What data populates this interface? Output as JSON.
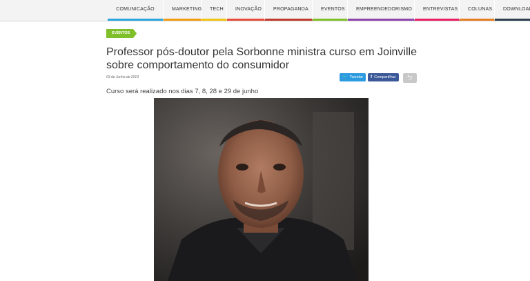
{
  "nav": [
    {
      "label": "COMUNICAÇÃO",
      "color": "#2aa6de"
    },
    {
      "label": "MARKETING",
      "color": "#f39c12"
    },
    {
      "label": "TECH",
      "color": "#f1c40f"
    },
    {
      "label": "INOVAÇÃO",
      "color": "#e74c3c"
    },
    {
      "label": "PROPAGANDA",
      "color": "#c0392b"
    },
    {
      "label": "EVENTOS",
      "color": "#7fbf2a"
    },
    {
      "label": "EMPREENDEDORISMO",
      "color": "#8e44ad"
    },
    {
      "label": "ENTREVISTAS",
      "color": "#e91e63"
    },
    {
      "label": "COLUNAS",
      "color": "#e67e22"
    },
    {
      "label": "DOWNLOADS",
      "color": "#2c3e50"
    }
  ],
  "article": {
    "tag": "EVENTOS",
    "title": "Professor pós-doutor pela Sorbonne ministra curso em Joinville sobre comportamento do consumidor",
    "date": "03 de Junho de 2019",
    "subtitle": "Curso será realizado nos dias 7, 8, 28 e 29 de junho"
  },
  "share": {
    "tweet_label": "Tweetar",
    "share_label": "Compartilhar"
  }
}
